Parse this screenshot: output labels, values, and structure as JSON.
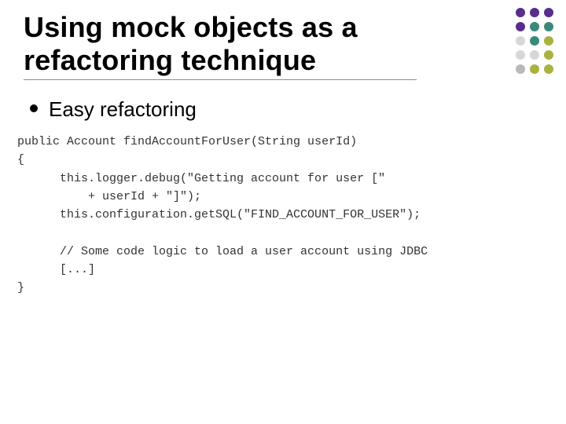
{
  "title_line1": "Using mock objects as a",
  "title_line2": "refactoring technique",
  "bullets": {
    "b1": "Easy refactoring"
  },
  "code": "public Account findAccountForUser(String userId)\n{\n      this.logger.debug(\"Getting account for user [\"\n          + userId + \"]\");\n      this.configuration.getSQL(\"FIND_ACCOUNT_FOR_USER\");\n\n      // Some code logic to load a user account using JDBC\n      [...]\n}"
}
